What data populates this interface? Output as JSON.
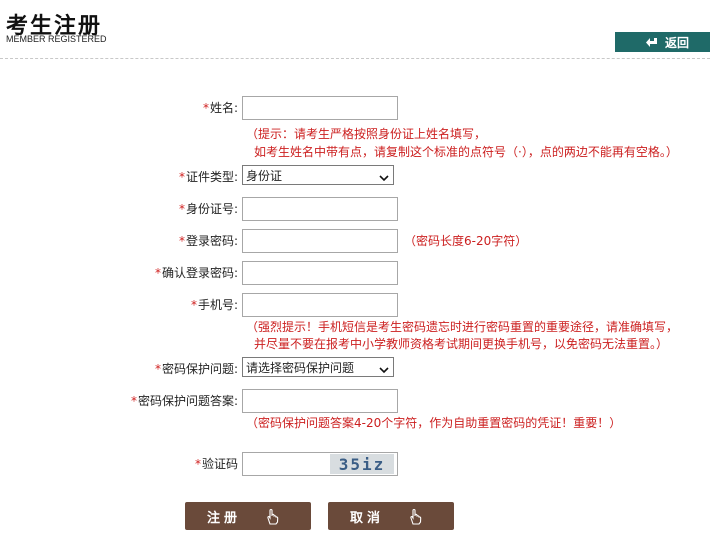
{
  "header": {
    "title": "考生注册",
    "subtitle": "MEMBER REGISTERED",
    "back_label": "返回"
  },
  "form": {
    "required_mark": "*",
    "name_label": "姓名:",
    "name_hint_line1": "（提示：请考生严格按照身份证上姓名填写，",
    "name_hint_line2": "如考生姓名中带有点，请复制这个标准的点符号（·），点的两边不能再有空格。）",
    "id_type_label": "证件类型:",
    "id_type_value": "身份证",
    "id_number_label": "身份证号:",
    "password_label": "登录密码:",
    "password_hint": "（密码长度6-20字符）",
    "confirm_password_label": "确认登录密码:",
    "phone_label": "手机号:",
    "phone_hint_line1": "（强烈提示！手机短信是考生密码遗忘时进行密码重置的重要途径，请准确填写，",
    "phone_hint_line2": "并尽量不要在报考中小学教师资格考试期间更换手机号，以免密码无法重置。）",
    "security_question_label": "密码保护问题:",
    "security_question_value": "请选择密码保护问题",
    "security_answer_label": "密码保护问题答案:",
    "security_answer_hint": "（密码保护问题答案4-20个字符，作为自助重置密码的凭证！重要！）",
    "captcha_label": "验证码",
    "captcha_text": "35iz"
  },
  "buttons": {
    "register": "注册",
    "cancel": "取消"
  },
  "colors": {
    "back_button": "#1f6a68",
    "action_button": "#6a4a3a",
    "hint_text": "#cc2020"
  }
}
